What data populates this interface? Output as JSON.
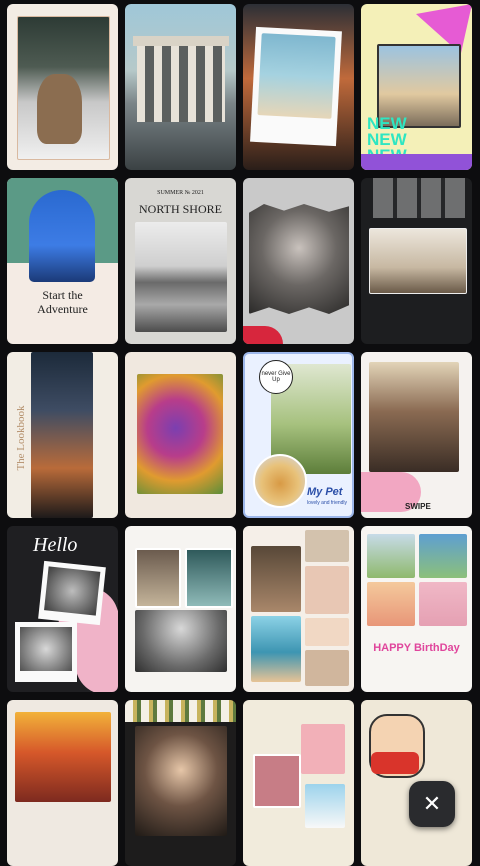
{
  "templates": [
    {
      "id": "husky",
      "title": ""
    },
    {
      "id": "gate",
      "title": ""
    },
    {
      "id": "beach-polaroid",
      "title": ""
    },
    {
      "id": "new-new-new",
      "title": "NEW NEW NEW"
    },
    {
      "id": "adventure",
      "title": "Start the Adventure"
    },
    {
      "id": "north-shore",
      "title": "NORTH SHORE",
      "subtitle": "SUMMER № 2021"
    },
    {
      "id": "torn-portrait",
      "title": ""
    },
    {
      "id": "window-room",
      "title": ""
    },
    {
      "id": "lookbook",
      "title": "The Lookbook"
    },
    {
      "id": "autumn-leaf",
      "title": ""
    },
    {
      "id": "my-pet",
      "title": "My Pet",
      "subtitle": "lovely and friendly",
      "tag": "never Give Up"
    },
    {
      "id": "swipe",
      "title": "SWIPE"
    },
    {
      "id": "hello",
      "title": "Hello"
    },
    {
      "id": "photo-collage",
      "title": ""
    },
    {
      "id": "couple-collage",
      "title": ""
    },
    {
      "id": "happy-birthday",
      "title": "HAPPY BirthDay"
    },
    {
      "id": "red-glasses",
      "title": ""
    },
    {
      "id": "flower-photo",
      "title": ""
    },
    {
      "id": "scrapbook",
      "title": ""
    },
    {
      "id": "shinchan",
      "title": ""
    }
  ],
  "close_button": {
    "glyph": "✕"
  },
  "colors": {
    "background": "#0d0d0f",
    "fab": "#2a2b2e"
  }
}
